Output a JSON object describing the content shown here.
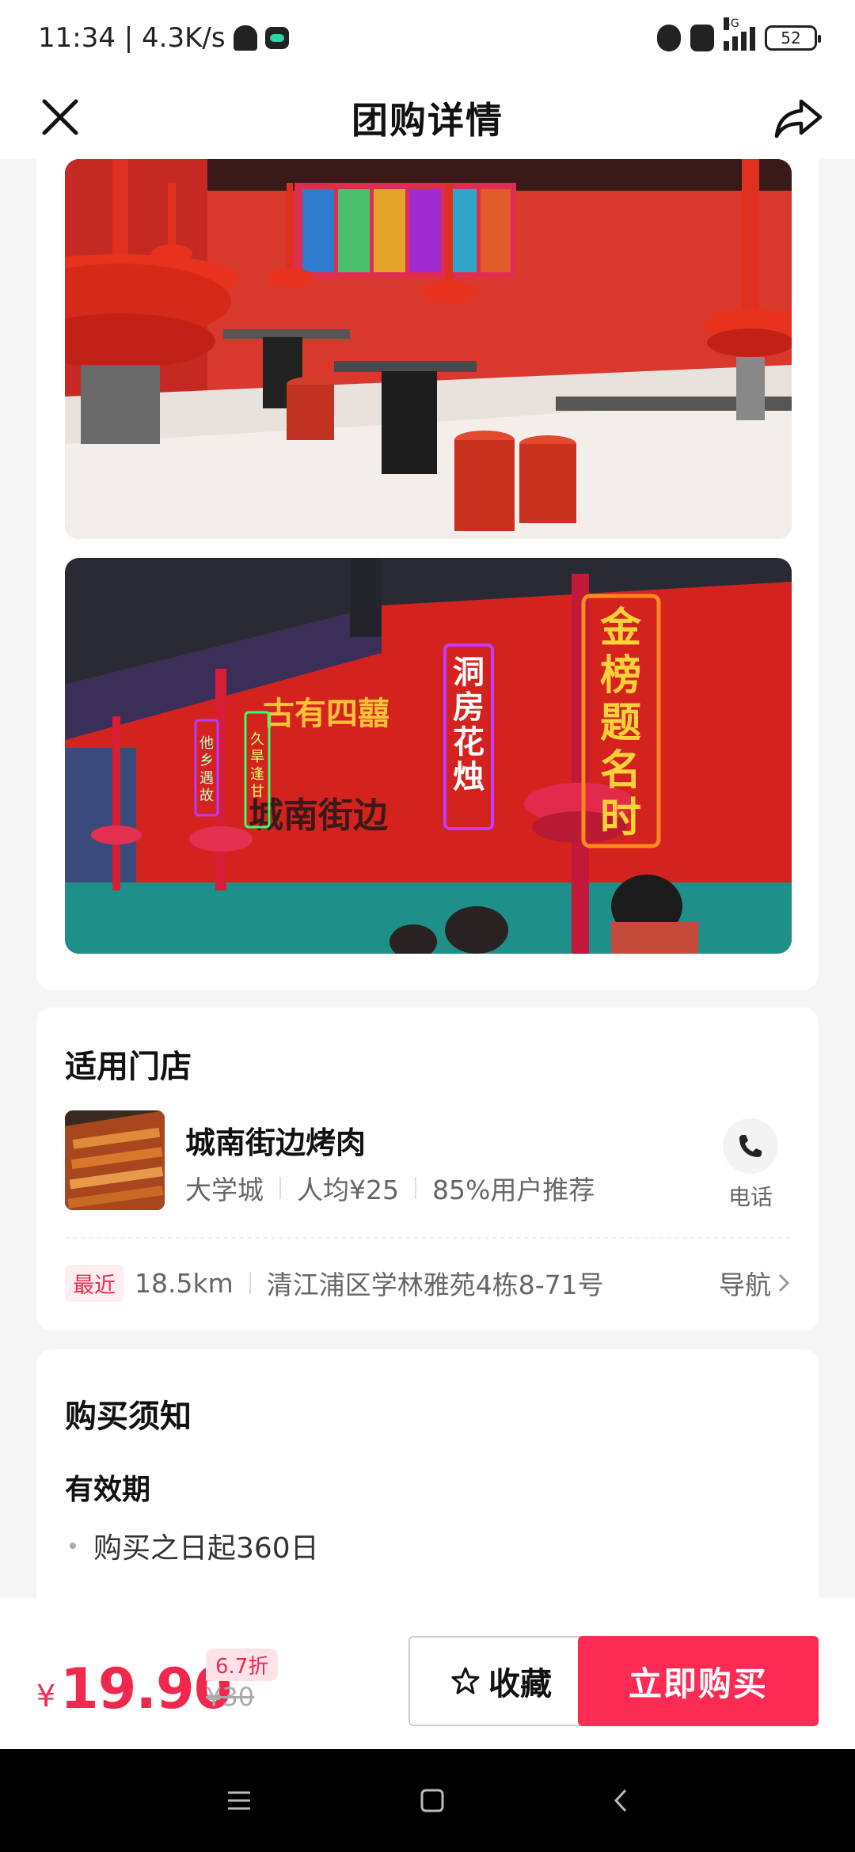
{
  "status_bar": {
    "time_speed": "11:34 | 4.3K/s",
    "network_type": "4G",
    "battery": "52"
  },
  "header": {
    "title": "团购详情",
    "close_icon": "close-icon",
    "share_icon": "share-icon"
  },
  "store_section": {
    "title": "适用门店",
    "store": {
      "name": "城南街边烤肉",
      "area": "大学城",
      "avg_price": "人均¥25",
      "recommend": "85%用户推荐",
      "phone_label": "电话",
      "nearest_tag": "最近",
      "distance": "18.5km",
      "address": "清江浦区学林雅苑4栋8-71号",
      "nav_label": "导航"
    }
  },
  "notice_section": {
    "title": "购买须知",
    "validity_title": "有效期",
    "validity_item": "购买之日起360日"
  },
  "bottom_bar": {
    "currency": "¥",
    "price": "19.90",
    "discount": "6.7折",
    "original_price": "¥30",
    "favorite_label": "收藏",
    "buy_label": "立即购买"
  },
  "colors": {
    "accent": "#fb2b54",
    "price": "#f0284e"
  },
  "sign_texts": {
    "vertical_1": "金榜题名时",
    "vertical_2": "洞房花烛",
    "arc": "古有四囍",
    "wall": "城南街边",
    "small_1": "他乡遇故",
    "small_2": "久旱逢甘"
  }
}
